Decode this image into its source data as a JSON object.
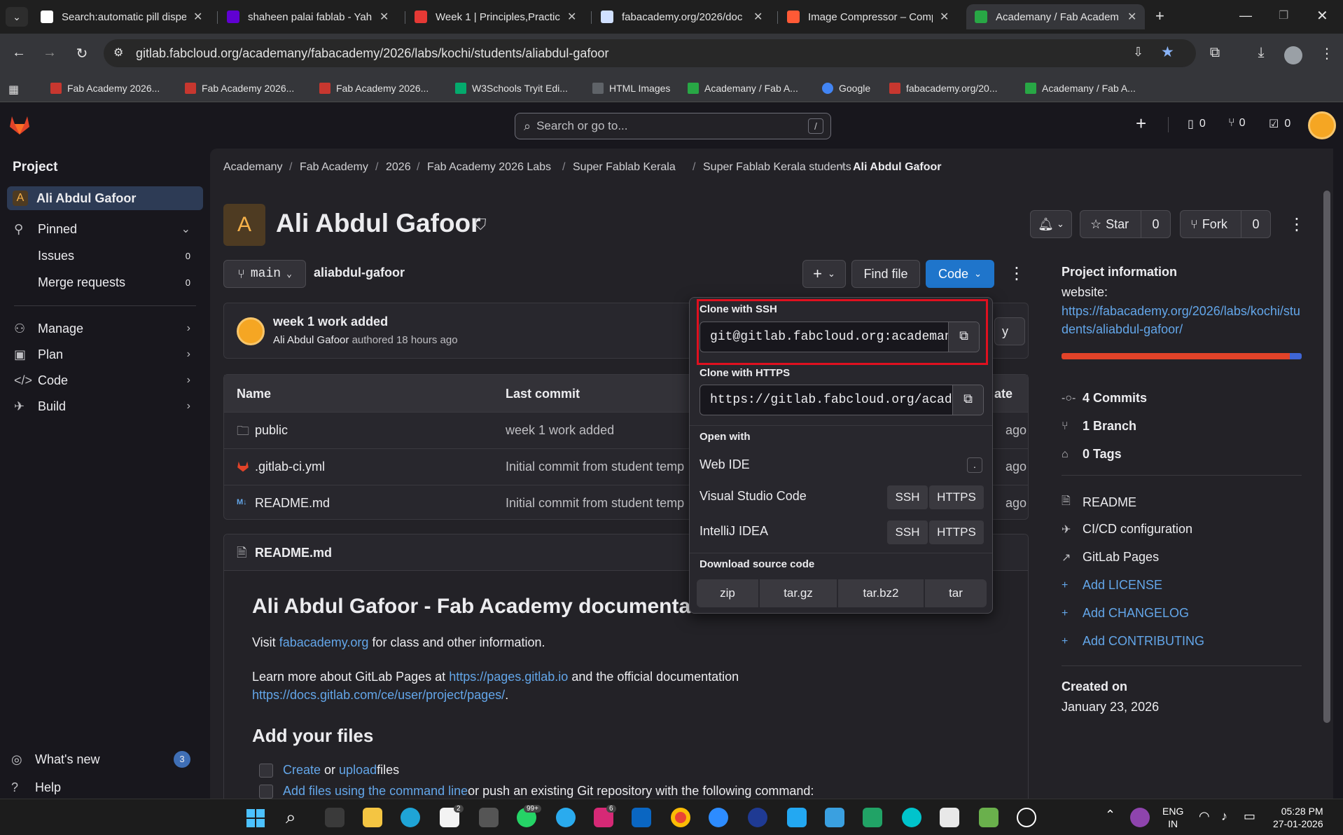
{
  "browser": {
    "tabs": [
      {
        "title": "Search:automatic pill dispe",
        "color": "#ffffff"
      },
      {
        "title": "shaheen palai fablab - Yah",
        "color": "#6001d2"
      },
      {
        "title": "Week 1 | Principles,Practic",
        "color": "#e53935"
      },
      {
        "title": "fabacademy.org/2026/doc",
        "color": "#d0e0ff"
      },
      {
        "title": "Image Compressor – Comp",
        "color": "#ff5a36"
      },
      {
        "title": "Academany / Fab Academ",
        "color": "#28a745"
      }
    ],
    "url": "gitlab.fabcloud.org/academany/fabacademy/2026/labs/kochi/students/aliabdul-gafoor",
    "bookmarks": [
      "Fab Academy 2026...",
      "Fab Academy 2026...",
      "Fab Academy 2026...",
      "W3Schools Tryit Edi...",
      "HTML Images",
      "Academany / Fab A...",
      "Google",
      "fabacademy.org/20...",
      "Academany / Fab A..."
    ]
  },
  "header": {
    "search_placeholder": "Search or go to...",
    "search_shortcut": "/",
    "issues_count": "0",
    "mr_count": "0",
    "todo_count": "0"
  },
  "sidebar": {
    "section": "Project",
    "project_letter": "A",
    "project_name": "Ali Abdul Gafoor",
    "pinned": "Pinned",
    "issues": "Issues",
    "issues_count": "0",
    "merge_requests": "Merge requests",
    "mr_count": "0",
    "manage": "Manage",
    "plan": "Plan",
    "code": "Code",
    "build": "Build",
    "whats_new": "What's new",
    "whats_new_count": "3",
    "help": "Help"
  },
  "breadcrumb": [
    "Academany",
    "Fab Academy",
    "2026",
    "Fab Academy 2026 Labs",
    "Super Fablab Kerala",
    "Super Fablab Kerala students",
    "Ali Abdul Gafoor"
  ],
  "project": {
    "avatar_letter": "A",
    "title": "Ali Abdul Gafoor",
    "star_label": "Star",
    "star_count": "0",
    "fork_label": "Fork",
    "fork_count": "0",
    "branch": "main",
    "path": "aliabdul-gafoor",
    "find_file": "Find file",
    "code_button": "Code"
  },
  "commit": {
    "message": "week 1 work added",
    "author": "Ali Abdul Gafoor",
    "meta": "authored 18 hours ago"
  },
  "files": {
    "col_name": "Name",
    "col_last_commit": "Last commit",
    "col_date": "ate",
    "rows": [
      {
        "name": "public",
        "commit": "week 1 work added",
        "date": "ago"
      },
      {
        "name": ".gitlab-ci.yml",
        "commit": "Initial commit from student temp",
        "date": "ago"
      },
      {
        "name": "README.md",
        "commit": "Initial commit from student temp",
        "date": "ago"
      }
    ]
  },
  "readme": {
    "filename": "README.md",
    "heading": "Ali Abdul Gafoor - Fab Academy documentation",
    "visit_prefix": "Visit ",
    "visit_link": "fabacademy.org",
    "visit_suffix": " for class and other information.",
    "learn_prefix": "Learn more about GitLab Pages at ",
    "learn_link1": "https://pages.gitlab.io",
    "learn_mid": " and the official documentation",
    "learn_link2": "https://docs.gitlab.com/ce/user/project/pages/",
    "learn_end": ".",
    "add_files_heading": "Add your files",
    "check1_link1": "Create",
    "check1_or": " or ",
    "check1_link2": "upload",
    "check1_end": " files",
    "check2_link": "Add files using the command line",
    "check2_end": " or push an existing Git repository with the following command:"
  },
  "clone_dropdown": {
    "ssh_label": "Clone with SSH",
    "ssh_url": "git@gitlab.fabcloud.org:academany/fabacademy/2026/labs/kochi/students/aliabdul-gafoor.git",
    "https_label": "Clone with HTTPS",
    "https_url": "https://gitlab.fabcloud.org/academany/fabacademy/2026/labs/kochi/students/aliabdul-gafoor.git",
    "open_with": "Open with",
    "web_ide": "Web IDE",
    "web_ide_key": ".",
    "vscode": "Visual Studio Code",
    "intellij": "IntelliJ IDEA",
    "ssh": "SSH",
    "https": "HTTPS",
    "download_label": "Download source code",
    "downloads": [
      "zip",
      "tar.gz",
      "tar.bz2",
      "tar"
    ],
    "highlight_color": "#e0101f"
  },
  "project_info": {
    "title": "Project information",
    "website_label": "website:",
    "website_url": "https://fabacademy.org/2026/labs/kochi/students/aliabdul-gafoor/",
    "commits": "4 Commits",
    "branches": "1 Branch",
    "tags": "0 Tags",
    "readme": "README",
    "cicd": "CI/CD configuration",
    "pages": "GitLab Pages",
    "add_license": "Add LICENSE",
    "add_changelog": "Add CHANGELOG",
    "add_contributing": "Add CONTRIBUTING",
    "created_on_label": "Created on",
    "created_on": "January 23, 2026",
    "language_bar": [
      {
        "color": "#e24329",
        "percent": 95
      },
      {
        "color": "#3f66d6",
        "percent": 5
      }
    ]
  },
  "taskbar": {
    "lang": "ENG",
    "region": "IN",
    "time": "05:28 PM",
    "date": "27-01-2026",
    "badge_store": "2",
    "badge_whatsapp": "99+",
    "badge_instagram": "6"
  }
}
